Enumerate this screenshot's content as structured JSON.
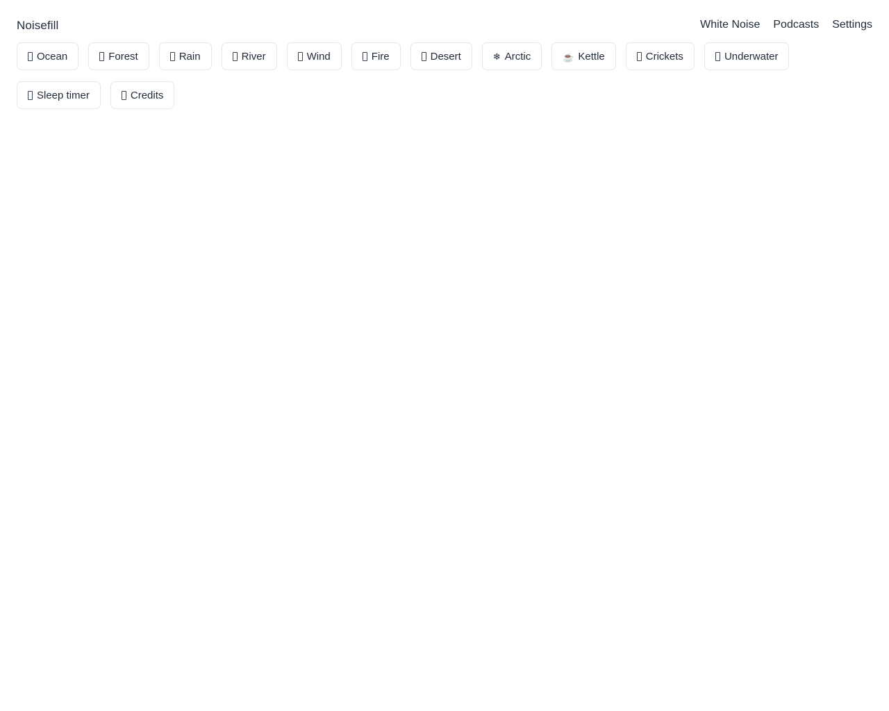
{
  "app": {
    "brand": "Noisefill",
    "background_color": "#ffffff",
    "text_color": "#1f2937",
    "button_border_color": "#e2e8f0"
  },
  "nav": {
    "items": [
      {
        "label": "White Noise",
        "name": "nav-link-white-noise"
      },
      {
        "label": "Podcasts",
        "name": "nav-link-podcasts"
      },
      {
        "label": "Settings",
        "name": "nav-link-settings"
      }
    ]
  },
  "presets": {
    "items": [
      {
        "label": "Ocean",
        "icon": "ocean-wave-icon",
        "glyph": "",
        "style": "tofu"
      },
      {
        "label": "Forest",
        "icon": "tree-icon",
        "glyph": "",
        "style": "tofu"
      },
      {
        "label": "Rain",
        "icon": "rain-cloud-icon",
        "glyph": "",
        "style": "tofu"
      },
      {
        "label": "River",
        "icon": "river-icon",
        "glyph": "",
        "style": "tofu"
      },
      {
        "label": "Wind",
        "icon": "wind-icon",
        "glyph": "",
        "style": "tofu"
      },
      {
        "label": "Fire",
        "icon": "fire-icon",
        "glyph": "",
        "style": "tofu"
      },
      {
        "label": "Desert",
        "icon": "desert-icon",
        "glyph": "",
        "style": "tofu"
      },
      {
        "label": "Arctic",
        "icon": "snowflake-icon",
        "glyph": "❄",
        "style": "snowflake"
      },
      {
        "label": "Kettle",
        "icon": "teapot-icon",
        "glyph": "☕",
        "style": "kettle"
      },
      {
        "label": "Crickets",
        "icon": "cricket-icon",
        "glyph": "",
        "style": "tofu"
      },
      {
        "label": "Underwater",
        "icon": "underwater-icon",
        "glyph": "",
        "style": "tofu"
      },
      {
        "label": "Sleep timer",
        "icon": "timer-icon",
        "glyph": "",
        "style": "tofu"
      },
      {
        "label": "Credits",
        "icon": "credits-icon",
        "glyph": "",
        "style": "tofu"
      }
    ]
  }
}
